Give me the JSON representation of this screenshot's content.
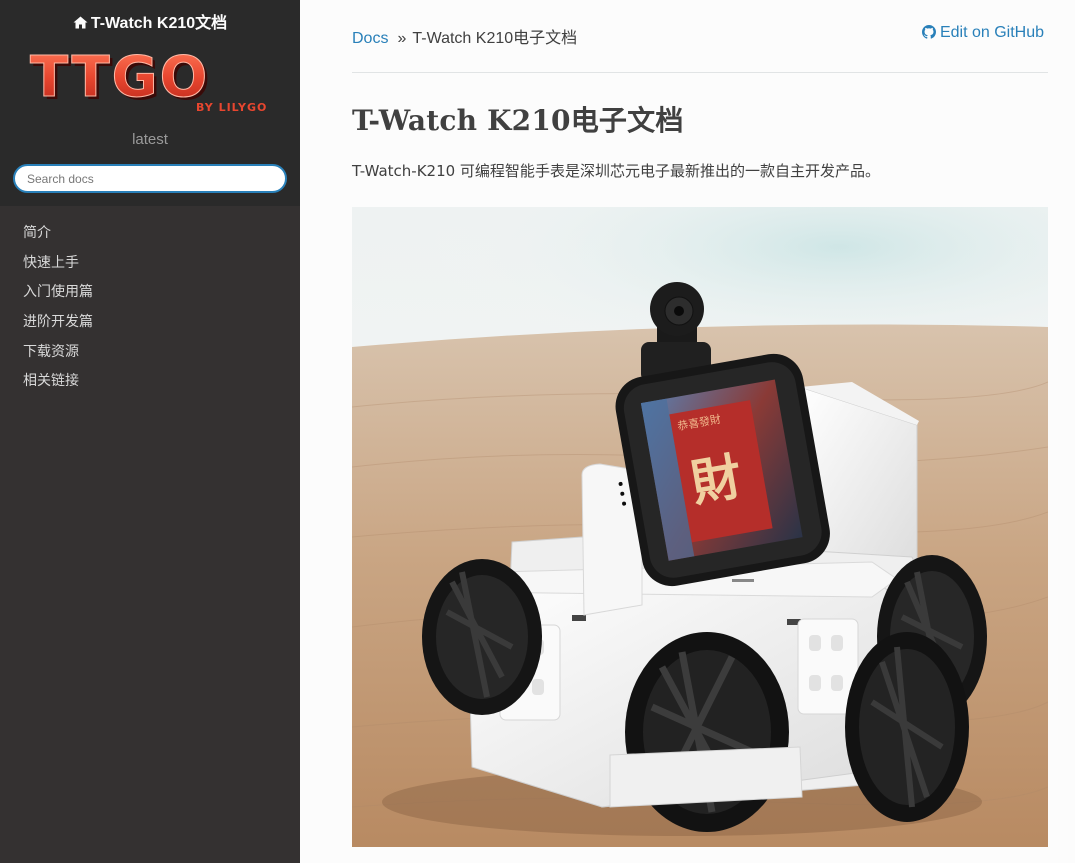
{
  "sidebar": {
    "project_title": "T-Watch K210文档",
    "logo_text": "TTGO",
    "logo_subtext": "BY LILYGO",
    "version": "latest",
    "search_placeholder": "Search docs",
    "items": [
      {
        "label": "简介"
      },
      {
        "label": "快速上手"
      },
      {
        "label": "入门使用篇"
      },
      {
        "label": "进阶开发篇"
      },
      {
        "label": "下载资源"
      },
      {
        "label": "相关链接"
      }
    ]
  },
  "header": {
    "breadcrumb_root": "Docs",
    "breadcrumb_sep": "»",
    "breadcrumb_current": "T-Watch K210电子文档",
    "edit_link": "Edit on GitHub"
  },
  "main": {
    "title": "T-Watch K210电子文档",
    "intro": "T-Watch-K210 可编程智能手表是深圳芯元电子最新推出的一款自主开发产品。",
    "screen_characters": {
      "top": "恭喜發財",
      "main": "財"
    }
  },
  "colors": {
    "sidebar_bg": "#343131",
    "sidebar_top_bg": "#2a2a2a",
    "link": "#2980b9",
    "logo_red": "#e8462f"
  },
  "icons": {
    "home": "home-icon",
    "github": "github-icon"
  }
}
